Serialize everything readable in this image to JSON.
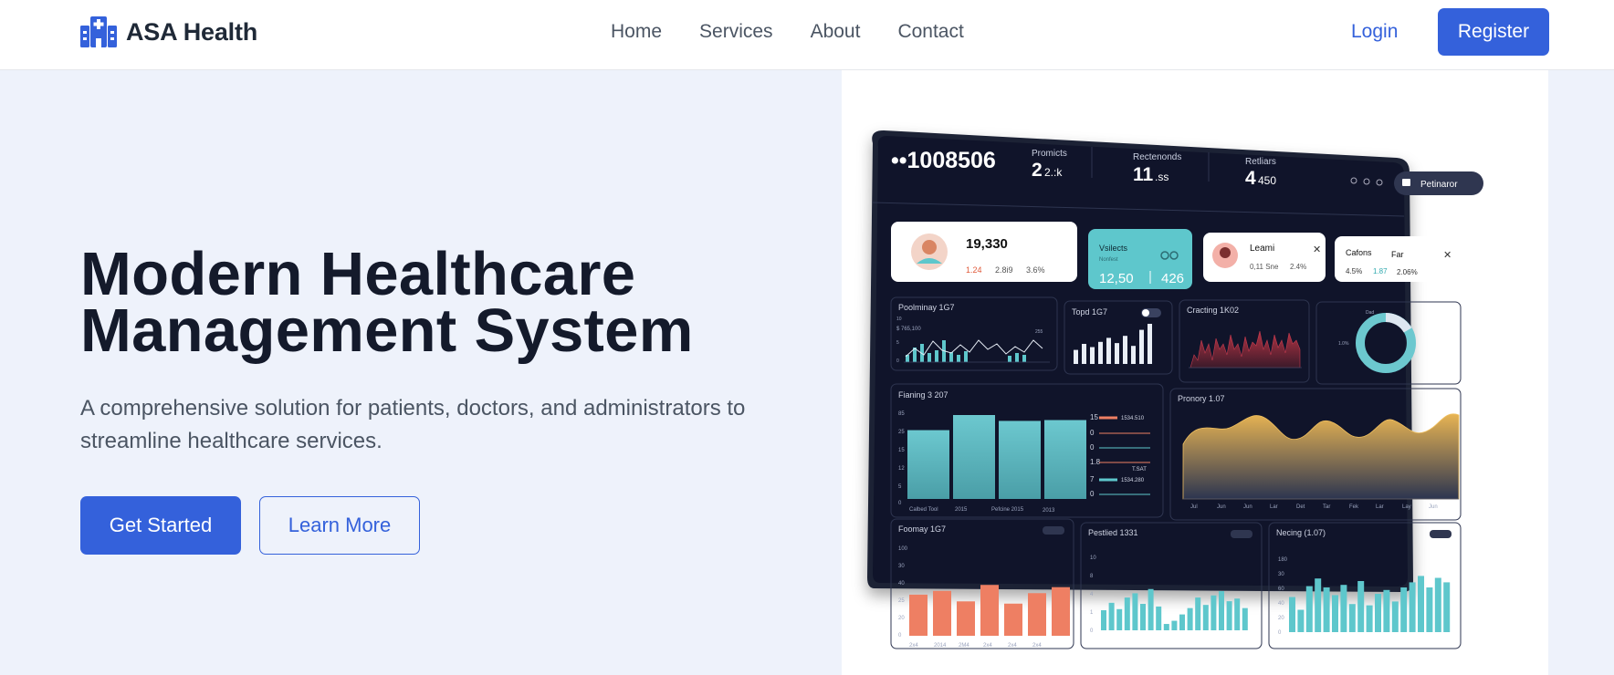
{
  "brand": {
    "name": "ASA Health",
    "icon": "hospital-icon",
    "accent": "#3461db"
  },
  "nav": {
    "links": [
      "Home",
      "Services",
      "About",
      "Contact"
    ],
    "login": "Login",
    "register": "Register"
  },
  "hero": {
    "title_line1": "Modern Healthcare",
    "title_line2": "Management System",
    "subtitle": "A comprehensive solution for patients, doctors, and administrators to streamline healthcare services.",
    "primary_cta": "Get Started",
    "secondary_cta": "Learn More"
  },
  "dashboard": {
    "header": {
      "id": "••1008506",
      "stats": [
        {
          "label": "Promicts",
          "value": "2",
          "suffix": "2.:k"
        },
        {
          "label": "Rectenonds",
          "value": "11",
          "suffix": ".ss"
        },
        {
          "label": "Retliars",
          "value": "4",
          "suffix": "450"
        }
      ],
      "pill": "Petinaror"
    },
    "cards": [
      {
        "value": "19,330",
        "subs": [
          "1.24",
          "2.8i9",
          "3.6%"
        ]
      },
      {
        "title": "Vsilects",
        "small": "Nonfest",
        "values": [
          "12,50",
          "426"
        ]
      },
      {
        "name": "Leami",
        "subs": [
          "0,11 Sne",
          "2.4%"
        ]
      },
      {
        "labels": [
          "Cafons",
          "Far"
        ],
        "subs": [
          "4.5%",
          "1.87",
          "2.06%"
        ]
      }
    ],
    "panels": [
      "Poolminay 1G7",
      "Topd 1G7",
      "Cracting 1K02",
      "Fianing 3 207",
      "Pronory 1.07",
      "Foomay 1G7",
      "Pestlied 1331",
      "Necing (1.07)"
    ],
    "ticks": {
      "p1": [
        "$ 765,100",
        "10",
        "5",
        "0",
        "255"
      ],
      "p4": [
        "85",
        "25",
        "15",
        "12",
        "5",
        "0"
      ],
      "p4x": [
        "Calbed Tool",
        "2015",
        "Pefcine 2015",
        "2013"
      ],
      "p4legend": [
        "15",
        "0",
        "0",
        "1.8",
        "7",
        "0"
      ],
      "p4vals": [
        "1534.510",
        "T.SAT",
        "1534.280"
      ],
      "p5x": [
        "Jul",
        "Jun",
        "Jun",
        "Lar",
        "Det",
        "Tar",
        "Fek",
        "Lar",
        "Lay",
        "Jun"
      ],
      "p6y": [
        "100",
        "30",
        "40",
        "25",
        "20",
        "0"
      ],
      "p6x": [
        "2x4",
        "2014",
        "2M4",
        "2x4",
        "2x4",
        "2x4"
      ],
      "p7y": [
        "10",
        "8",
        "4",
        "1",
        "0"
      ],
      "p8y": [
        "180",
        "30",
        "60",
        "40",
        "20",
        "0"
      ]
    },
    "series": {
      "p2": [
        0.35,
        0.5,
        0.42,
        0.55,
        0.65,
        0.52,
        0.7,
        0.45,
        0.85,
        1
      ],
      "p4": [
        0.82,
        1,
        0.93,
        0.94
      ],
      "p6": [
        0.55,
        0.6,
        0.46,
        0.68,
        0.43,
        0.57,
        0.65
      ],
      "p7": [
        0.38,
        0.52,
        0.4,
        0.62,
        0.7,
        0.5,
        0.78,
        0.45,
        0.12,
        0.18,
        0.3,
        0.42,
        0.62,
        0.48,
        0.66,
        0.74,
        0.55,
        0.6,
        0.42
      ],
      "p8": [
        0.55,
        0.35,
        0.72,
        0.84,
        0.7,
        0.58,
        0.74,
        0.44,
        0.8,
        0.42,
        0.6,
        0.66,
        0.48,
        0.7,
        0.78,
        0.88,
        0.7,
        0.85,
        0.78
      ]
    },
    "colors": {
      "bg": "#10142a",
      "teal": "#5ec7cc",
      "coral": "#ee7f63",
      "gold": "#e4ae4e",
      "red": "#a0303e"
    }
  }
}
